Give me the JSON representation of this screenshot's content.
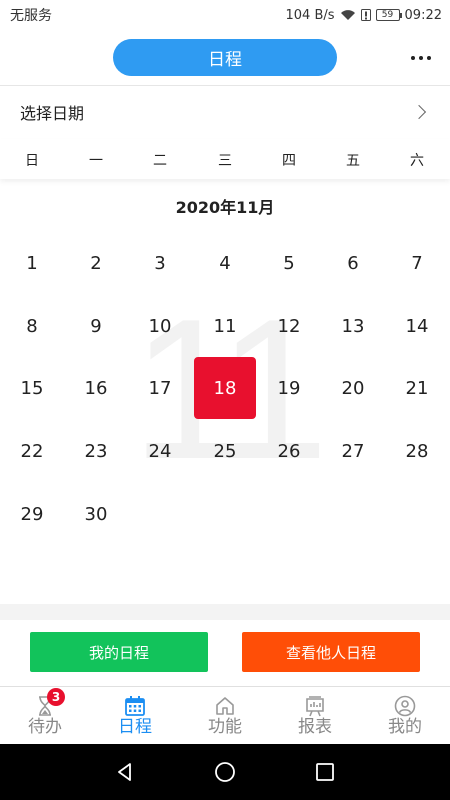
{
  "status_bar": {
    "carrier": "无服务",
    "speed": "104 B/s",
    "battery": "59",
    "time": "09:22"
  },
  "header": {
    "title": "日程"
  },
  "date_selector": {
    "label": "选择日期"
  },
  "weekdays": [
    "日",
    "一",
    "二",
    "三",
    "四",
    "五",
    "六"
  ],
  "calendar": {
    "month_title": "2020年11月",
    "watermark": "11",
    "selected_day": "18",
    "weeks": [
      [
        "1",
        "2",
        "3",
        "4",
        "5",
        "6",
        "7"
      ],
      [
        "8",
        "9",
        "10",
        "11",
        "12",
        "13",
        "14"
      ],
      [
        "15",
        "16",
        "17",
        "18",
        "19",
        "20",
        "21"
      ],
      [
        "22",
        "23",
        "24",
        "25",
        "26",
        "27",
        "28"
      ],
      [
        "29",
        "30"
      ]
    ]
  },
  "actions": {
    "my_schedule": "我的日程",
    "others_schedule": "查看他人日程",
    "my_color": "#12c35b",
    "others_color": "#ff4e07"
  },
  "tabbar": {
    "active_color": "#1c8ef2",
    "tabs": [
      {
        "label": "待办",
        "icon": "hourglass-icon",
        "badge": "3"
      },
      {
        "label": "日程",
        "icon": "calendar-icon"
      },
      {
        "label": "功能",
        "icon": "home-icon"
      },
      {
        "label": "报表",
        "icon": "report-icon"
      },
      {
        "label": "我的",
        "icon": "user-icon"
      }
    ]
  }
}
